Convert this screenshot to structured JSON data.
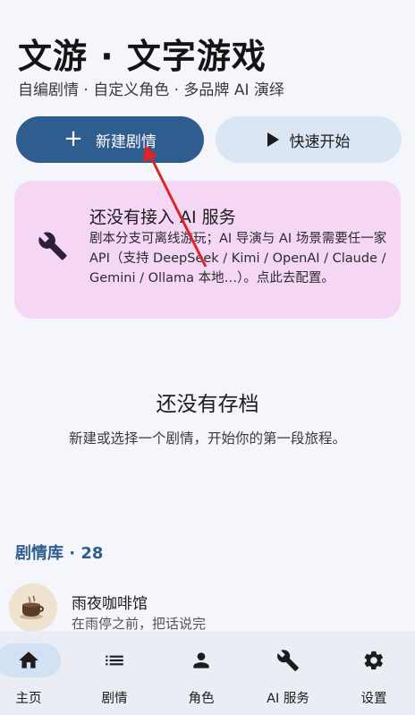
{
  "header": {
    "title": "文游 · 文字游戏",
    "subtitle": "自编剧情 · 自定义角色 · 多品牌 AI 演绎"
  },
  "actions": {
    "new_story_label": "新建剧情",
    "quick_start_label": "快速开始"
  },
  "ai_alert": {
    "title": "还没有接入 AI 服务",
    "description": "剧本分支可离线游玩；AI 导演与 AI 场景需要任一家 API（支持 DeepSeek / Kimi / OpenAI / Claude / Gemini / Ollama 本地…）。点此去配置。"
  },
  "saves_empty": {
    "title": "还没有存档",
    "description": "新建或选择一个剧情，开始你的第一段旅程。"
  },
  "library": {
    "header": "剧情库 · 28",
    "items": [
      {
        "title": "雨夜咖啡馆",
        "subtitle": "在雨停之前，把话说完",
        "icon": "coffee-cup-icon"
      }
    ]
  },
  "bottom_nav": {
    "items": [
      {
        "label": "主页",
        "icon": "home-icon",
        "active": true
      },
      {
        "label": "剧情",
        "icon": "list-icon",
        "active": false
      },
      {
        "label": "角色",
        "icon": "person-icon",
        "active": false
      },
      {
        "label": "AI 服务",
        "icon": "wrench-icon",
        "active": false
      },
      {
        "label": "设置",
        "icon": "gear-icon",
        "active": false
      }
    ]
  },
  "colors": {
    "primary": "#2f5d8f",
    "secondary_button": "#dbe6f4",
    "alert_background": "#f5d7f5",
    "page_background": "#f4f6fb",
    "annotation_arrow": "#d62828"
  }
}
